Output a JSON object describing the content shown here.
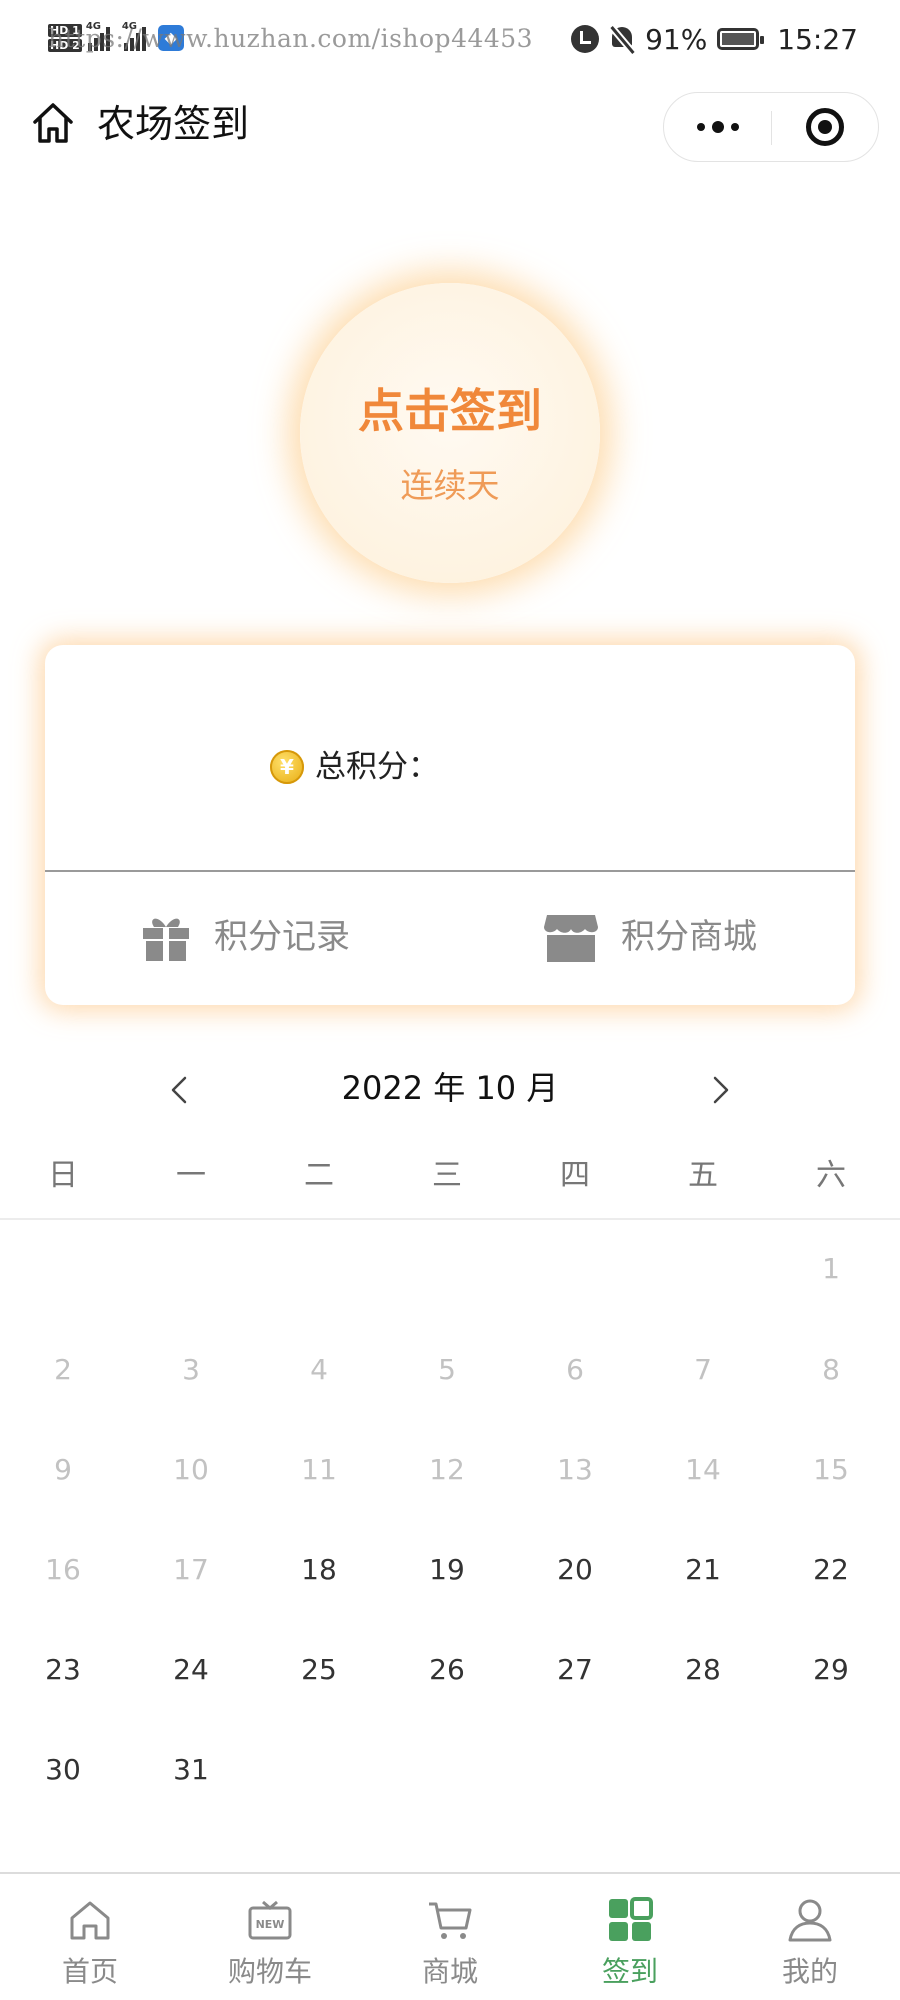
{
  "status_bar": {
    "watermark": "https://www.huzhan.com/ishop44453",
    "sim1_label": "HD 1",
    "sim2_label": "HD 2",
    "network1": "4G",
    "network2": "4G",
    "battery_percent": "91%",
    "time": "15:27"
  },
  "navbar": {
    "title": "农场签到"
  },
  "sign_in": {
    "button_label": "点击签到",
    "streak_label": "连续天"
  },
  "points": {
    "coin_symbol": "¥",
    "total_label": "总积分：",
    "records_label": "积分记录",
    "mall_label": "积分商城"
  },
  "calendar": {
    "title": "2022 年 10 月",
    "weekdays": [
      "日",
      "一",
      "二",
      "三",
      "四",
      "五",
      "六"
    ],
    "days": [
      {
        "d": "1",
        "past": true
      },
      {
        "d": "2",
        "past": true
      },
      {
        "d": "3",
        "past": true
      },
      {
        "d": "4",
        "past": true
      },
      {
        "d": "5",
        "past": true
      },
      {
        "d": "6",
        "past": true
      },
      {
        "d": "7",
        "past": true
      },
      {
        "d": "8",
        "past": true
      },
      {
        "d": "9",
        "past": true
      },
      {
        "d": "10",
        "past": true
      },
      {
        "d": "11",
        "past": true
      },
      {
        "d": "12",
        "past": true
      },
      {
        "d": "13",
        "past": true
      },
      {
        "d": "14",
        "past": true
      },
      {
        "d": "15",
        "past": true
      },
      {
        "d": "16",
        "past": true
      },
      {
        "d": "17",
        "past": true
      },
      {
        "d": "18",
        "past": false
      },
      {
        "d": "19",
        "past": false
      },
      {
        "d": "20",
        "past": false
      },
      {
        "d": "21",
        "past": false
      },
      {
        "d": "22",
        "past": false
      },
      {
        "d": "23",
        "past": false
      },
      {
        "d": "24",
        "past": false
      },
      {
        "d": "25",
        "past": false
      },
      {
        "d": "26",
        "past": false
      },
      {
        "d": "27",
        "past": false
      },
      {
        "d": "28",
        "past": false
      },
      {
        "d": "29",
        "past": false
      },
      {
        "d": "30",
        "past": false
      },
      {
        "d": "31",
        "past": false
      }
    ]
  },
  "tabbar": {
    "items": [
      {
        "label": "首页",
        "icon": "home-icon"
      },
      {
        "label": "购物车",
        "icon": "new-box-icon"
      },
      {
        "label": "商城",
        "icon": "cart-icon"
      },
      {
        "label": "签到",
        "icon": "grid-icon",
        "active": true
      },
      {
        "label": "我的",
        "icon": "user-icon"
      }
    ]
  },
  "colors": {
    "accent_orange": "#f0883a",
    "active_green": "#4aa05e",
    "inactive_gray": "#8a8a8a"
  }
}
